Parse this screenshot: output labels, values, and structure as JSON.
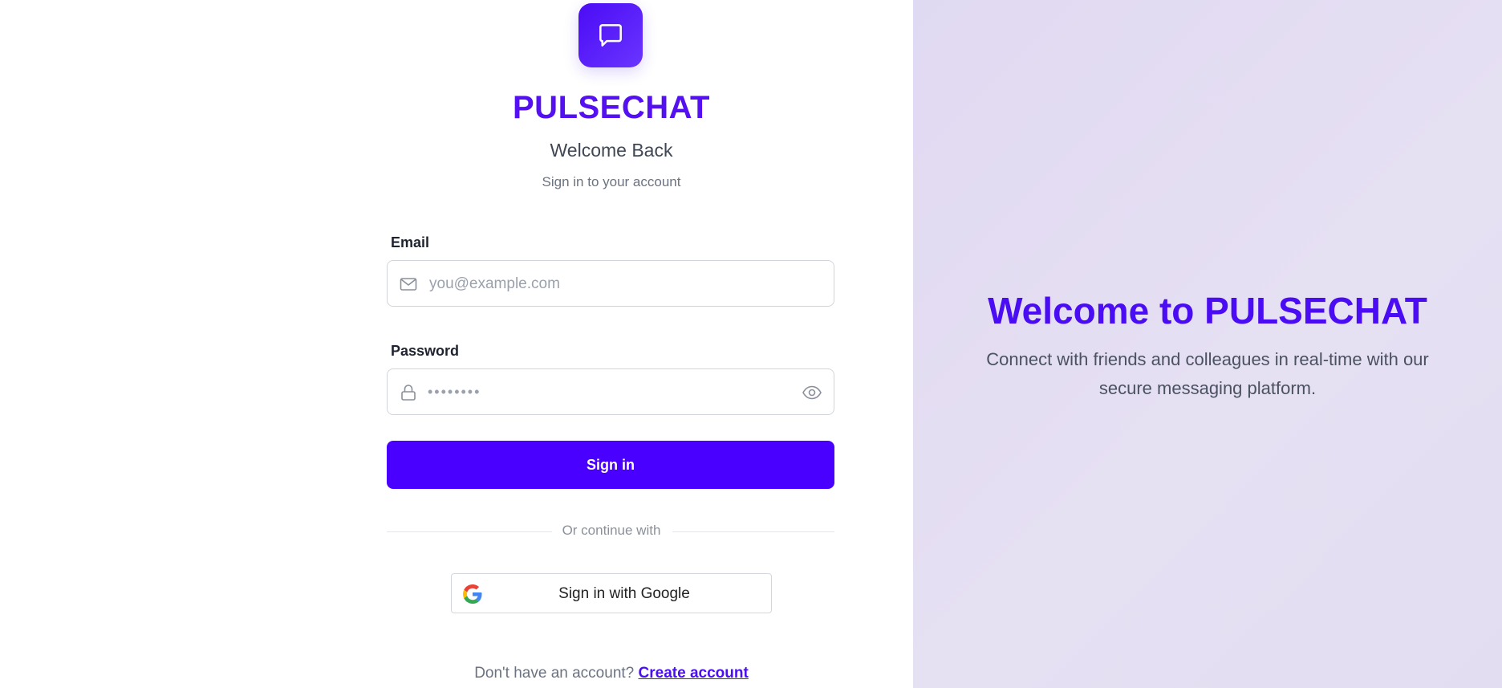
{
  "brand": {
    "name": "PULSECHAT",
    "heading": "Welcome Back",
    "subheading": "Sign in to your account",
    "logo_icon": "chat-bubble-icon",
    "accent_color": "#4a00ff"
  },
  "form": {
    "email_label": "Email",
    "email_placeholder": "you@example.com",
    "email_icon": "mail-icon",
    "password_label": "Password",
    "password_value": "••••••••",
    "password_icon": "lock-icon",
    "password_toggle_icon": "eye-icon",
    "submit_label": "Sign in"
  },
  "divider": {
    "text": "Or continue with"
  },
  "google": {
    "label": "Sign in with Google",
    "icon": "google-icon"
  },
  "footer": {
    "prompt": "Don't have an account?",
    "link_label": "Create account"
  },
  "hero": {
    "title": "Welcome to PULSECHAT",
    "text": "Connect with friends and colleagues in real-time with our secure messaging platform."
  }
}
